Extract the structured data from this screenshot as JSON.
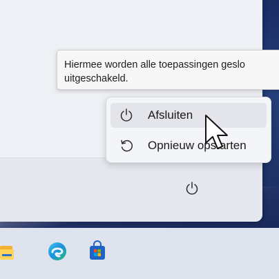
{
  "tooltip": {
    "text": "Hiermee worden alle toepassingen geslo\nuitgeschakeld."
  },
  "power_menu": {
    "items": [
      {
        "label": "Afsluiten",
        "icon": "power-icon",
        "hover": true
      },
      {
        "label": "Opnieuw opstarten",
        "icon": "restart-icon",
        "hover": false
      }
    ]
  },
  "start_menu": {
    "power_button_icon": "power-icon"
  },
  "taskbar": {
    "icons": [
      "file-explorer-icon",
      "edge-browser-icon",
      "microsoft-store-icon"
    ]
  },
  "colors": {
    "menu_background": "#f4f5f8",
    "hover_background": "#e3e5ea",
    "taskbar_background": "#dfe3ee",
    "wallpaper": "#1b2b60"
  }
}
